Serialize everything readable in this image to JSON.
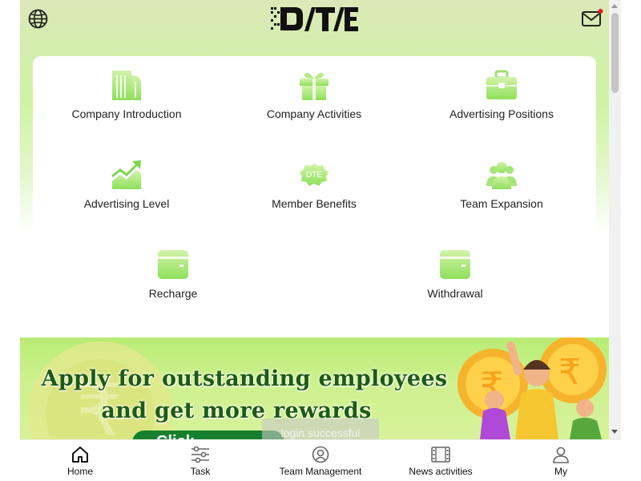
{
  "header": {
    "logo_text": "DTE",
    "language_icon": "globe-icon",
    "message_icon": "mail-icon",
    "unread_dot_color": "#e02020"
  },
  "grid": {
    "items": [
      {
        "label": "Company Introduction",
        "icon": "building-icon"
      },
      {
        "label": "Company Activities",
        "icon": "gift-icon"
      },
      {
        "label": "Advertising Positions",
        "icon": "briefcase-icon"
      },
      {
        "label": "Advertising Level",
        "icon": "trend-chart-icon"
      },
      {
        "label": "Member Benefits",
        "icon": "dte-badge-icon"
      },
      {
        "label": "Team Expansion",
        "icon": "team-icon"
      },
      {
        "label": "Recharge",
        "icon": "wallet-icon"
      },
      {
        "label": "Withdrawal",
        "icon": "wallet-icon"
      }
    ],
    "icon_color": "#8fe05c"
  },
  "banner": {
    "line1": "Apply for outstanding employees",
    "line2": "and get more rewards",
    "button_text": "Click",
    "currency_symbol": "₹"
  },
  "toast": {
    "text": "login successful"
  },
  "bottom_nav": {
    "items": [
      {
        "label": "Home",
        "icon": "home-icon",
        "active": true
      },
      {
        "label": "Task",
        "icon": "sliders-icon",
        "active": false
      },
      {
        "label": "Team Management",
        "icon": "user-circle-icon",
        "active": false
      },
      {
        "label": "News activities",
        "icon": "film-icon",
        "active": false
      },
      {
        "label": "My",
        "icon": "person-icon",
        "active": false
      }
    ]
  }
}
